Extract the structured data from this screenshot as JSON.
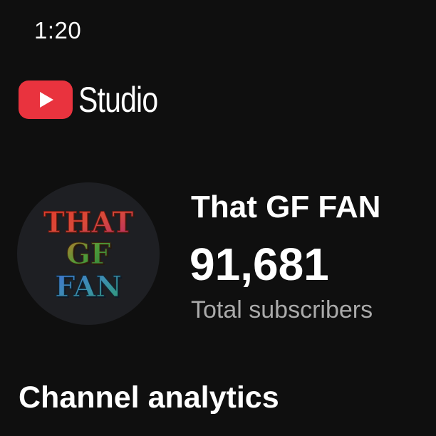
{
  "status_bar": {
    "time": "1:20"
  },
  "header": {
    "brand": "Studio",
    "logo_icon": "youtube-play-icon",
    "logo_color": "#e9333e"
  },
  "channel": {
    "name": "That GF FAN",
    "avatar_lines": [
      "THAT",
      "GF",
      "FAN"
    ],
    "subscriber_count": "91,681",
    "subscriber_label": "Total subscribers"
  },
  "section": {
    "title": "Channel analytics"
  }
}
